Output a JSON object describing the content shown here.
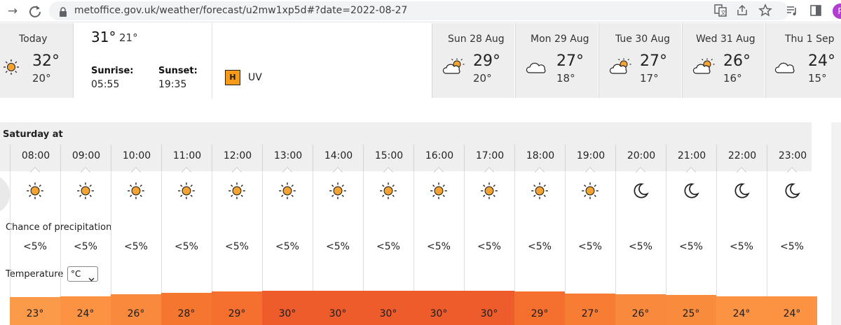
{
  "browser": {
    "url": "metoffice.gov.uk/weather/forecast/u2mw1xp5d#?date=2022-08-27",
    "profile_initial": "P"
  },
  "today": {
    "label": "Today",
    "max": "32°",
    "min": "20°",
    "icon": "sun-icon"
  },
  "today_detail": {
    "max": "31°",
    "min": "21°",
    "sunrise_label": "Sunrise:",
    "sunrise": "05:55",
    "sunset_label": "Sunset:",
    "sunset": "19:35",
    "uv_level": "H",
    "uv_label": "UV"
  },
  "days": [
    {
      "name": "Sun 28 Aug",
      "max": "29°",
      "min": "20°",
      "icon": "sun-cloud-icon"
    },
    {
      "name": "Mon 29 Aug",
      "max": "27°",
      "min": "18°",
      "icon": "cloud-icon"
    },
    {
      "name": "Tue 30 Aug",
      "max": "27°",
      "min": "17°",
      "icon": "sun-cloud-icon"
    },
    {
      "name": "Wed 31 Aug",
      "max": "26°",
      "min": "16°",
      "icon": "sun-cloud-icon"
    },
    {
      "name": "Thu 1 Sep",
      "max": "24°",
      "min": "15°",
      "icon": "cloud-icon"
    }
  ],
  "hourly": {
    "heading": "Saturday at",
    "precip_label": "Chance of precipitation",
    "temp_label": "Temperature",
    "unit": "°C",
    "hours": [
      {
        "time": "08:00",
        "icon": "sun-icon",
        "precip": "<5%",
        "temp": "23°",
        "temp_c": 23
      },
      {
        "time": "09:00",
        "icon": "sun-icon",
        "precip": "<5%",
        "temp": "24°",
        "temp_c": 24
      },
      {
        "time": "10:00",
        "icon": "sun-icon",
        "precip": "<5%",
        "temp": "26°",
        "temp_c": 26
      },
      {
        "time": "11:00",
        "icon": "sun-icon",
        "precip": "<5%",
        "temp": "28°",
        "temp_c": 28
      },
      {
        "time": "12:00",
        "icon": "sun-icon",
        "precip": "<5%",
        "temp": "29°",
        "temp_c": 29
      },
      {
        "time": "13:00",
        "icon": "sun-icon",
        "precip": "<5%",
        "temp": "30°",
        "temp_c": 30
      },
      {
        "time": "14:00",
        "icon": "sun-icon",
        "precip": "<5%",
        "temp": "30°",
        "temp_c": 30
      },
      {
        "time": "15:00",
        "icon": "sun-icon",
        "precip": "<5%",
        "temp": "30°",
        "temp_c": 30
      },
      {
        "time": "16:00",
        "icon": "sun-icon",
        "precip": "<5%",
        "temp": "30°",
        "temp_c": 30
      },
      {
        "time": "17:00",
        "icon": "sun-icon",
        "precip": "<5%",
        "temp": "30°",
        "temp_c": 30
      },
      {
        "time": "18:00",
        "icon": "sun-icon",
        "precip": "<5%",
        "temp": "29°",
        "temp_c": 29
      },
      {
        "time": "19:00",
        "icon": "sun-icon",
        "precip": "<5%",
        "temp": "27°",
        "temp_c": 27
      },
      {
        "time": "20:00",
        "icon": "moon-icon",
        "precip": "<5%",
        "temp": "26°",
        "temp_c": 26
      },
      {
        "time": "21:00",
        "icon": "moon-icon",
        "precip": "<5%",
        "temp": "25°",
        "temp_c": 25
      },
      {
        "time": "22:00",
        "icon": "moon-icon",
        "precip": "<5%",
        "temp": "24°",
        "temp_c": 24
      },
      {
        "time": "23:00",
        "icon": "moon-icon",
        "precip": "<5%",
        "temp": "24°",
        "temp_c": 24
      }
    ]
  },
  "colors": {
    "sun": "#f5a431",
    "uv_high": "#f79a1a",
    "temp_23": "#fb9a48",
    "temp_24": "#fb9342",
    "temp_25": "#f98c3c",
    "temp_26": "#f98a3d",
    "temp_27": "#f77d35",
    "temp_28": "#f5772f",
    "temp_29": "#f56f2f",
    "temp_30": "#ee5c2c"
  }
}
